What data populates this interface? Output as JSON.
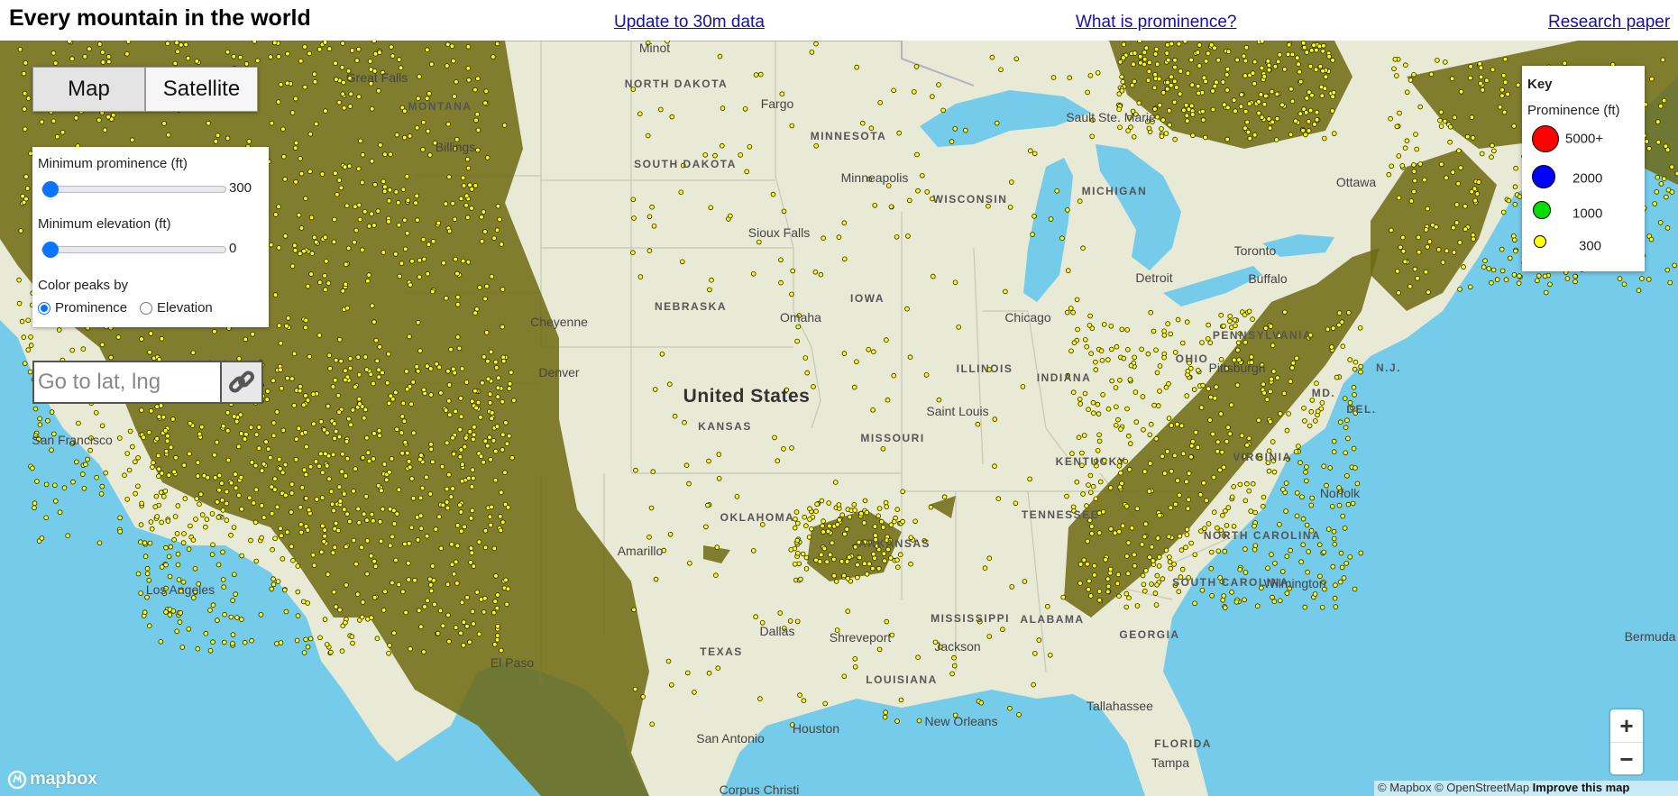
{
  "header": {
    "title": "Every mountain in the world",
    "links": [
      {
        "label": "Update to 30m data"
      },
      {
        "label": "What is prominence?"
      },
      {
        "label": "Research paper"
      }
    ]
  },
  "basemap_toggle": {
    "options": [
      "Map",
      "Satellite"
    ],
    "selected": "Map"
  },
  "controls": {
    "min_prominence_label": "Minimum prominence (ft)",
    "min_prominence_value": "300",
    "min_elevation_label": "Minimum elevation (ft)",
    "min_elevation_value": "0",
    "color_by_label": "Color peaks by",
    "color_by_options": [
      "Prominence",
      "Elevation"
    ],
    "color_by_selected": "Prominence"
  },
  "goto": {
    "placeholder": "Go to lat, lng"
  },
  "key": {
    "title": "Key",
    "subtitle": "Prominence (ft)",
    "entries": [
      {
        "label": "5000+",
        "color": "#ff0000"
      },
      {
        "label": "2000",
        "color": "#0000ff"
      },
      {
        "label": "1000",
        "color": "#00dd00"
      },
      {
        "label": "300",
        "color": "#ffff00"
      }
    ]
  },
  "map": {
    "country_labels": [
      "United States"
    ],
    "state_labels": [
      "NORTH DAKOTA",
      "SOUTH DAKOTA",
      "MONTANA",
      "MINNESOTA",
      "WISCONSIN",
      "MICHIGAN",
      "NEBRASKA",
      "IOWA",
      "ILLINOIS",
      "INDIANA",
      "OHIO",
      "KANSAS",
      "MISSOURI",
      "KENTUCKY",
      "OKLAHOMA",
      "ARKANSAS",
      "TEXAS",
      "LOUISIANA",
      "MISSISSIPPI",
      "ALABAMA",
      "GEORGIA",
      "FLORIDA",
      "SOUTH CAROLINA",
      "NORTH CAROLINA",
      "VIRGINIA",
      "PENNSYLVANIA",
      "MD.",
      "DEL.",
      "N.J.",
      "TENNESSEE"
    ],
    "city_labels": [
      "Minot",
      "Fargo",
      "Great Falls",
      "Billings",
      "Minneapolis",
      "Sioux Falls",
      "Omaha",
      "Chicago",
      "Detroit",
      "Toronto",
      "Ottawa",
      "Buffalo",
      "Pittsburgh",
      "Saint Louis",
      "Cheyenne",
      "Denver",
      "Amarillo",
      "Dallas",
      "Shreveport",
      "Jackson",
      "Houston",
      "San Antonio",
      "New Orleans",
      "Tallahassee",
      "Tampa",
      "Wilmington",
      "Norfolk",
      "Bermuda",
      "Corpus Christi",
      "Los Angeles",
      "San Francisco",
      "El Paso",
      "Sault Ste. Marie"
    ],
    "marker_fill": "#ffff00",
    "marker_stroke": "#222200",
    "water_color": "#74cbea",
    "land_color": "#e9ebd9"
  },
  "zoom": {
    "in": "+",
    "out": "−"
  },
  "mapbox_logo": "mapbox",
  "attribution": {
    "mapbox": "© Mapbox",
    "osm": "© OpenStreetMap",
    "improve": "Improve this map"
  }
}
